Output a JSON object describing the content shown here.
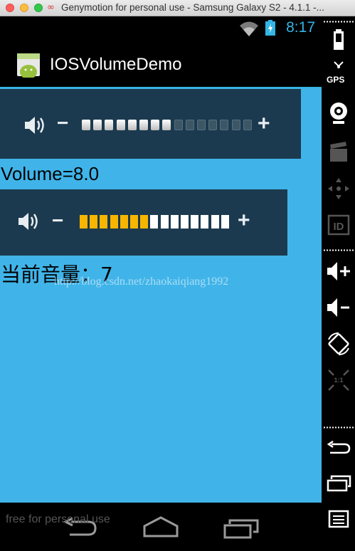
{
  "window": {
    "title": "Genymotion for personal use - Samsung Galaxy S2 - 4.1.1 -...",
    "logo_glyph": "∞"
  },
  "status_bar": {
    "time": "8:17"
  },
  "action_bar": {
    "title": "IOSVolumeDemo"
  },
  "volume_control_1": {
    "minus": "−",
    "plus": "+",
    "level": 8,
    "max": 15
  },
  "volume_text": "Volume=8.0",
  "volume_control_2": {
    "minus": "−",
    "plus": "+",
    "level": 7,
    "max": 15,
    "active_color": "#f7b500"
  },
  "current_volume_text": "当前音量：7",
  "watermark": "http://blog.csdn.net/zhaokaiqiang1992",
  "footer_text": "free for personal use",
  "sidebar": {
    "gps_label": "GPS",
    "icons": [
      "battery-icon",
      "gps-icon",
      "camera-icon",
      "video-icon",
      "dpad-icon",
      "id-icon",
      "volume-up-icon",
      "volume-down-icon",
      "rotate-icon",
      "scale-icon",
      "back-icon",
      "recent-apps-icon",
      "menu-icon"
    ]
  },
  "colors": {
    "content_bg": "#40b4e9",
    "panel_bg": "#1b3a4f",
    "accent": "#33b5e5"
  }
}
